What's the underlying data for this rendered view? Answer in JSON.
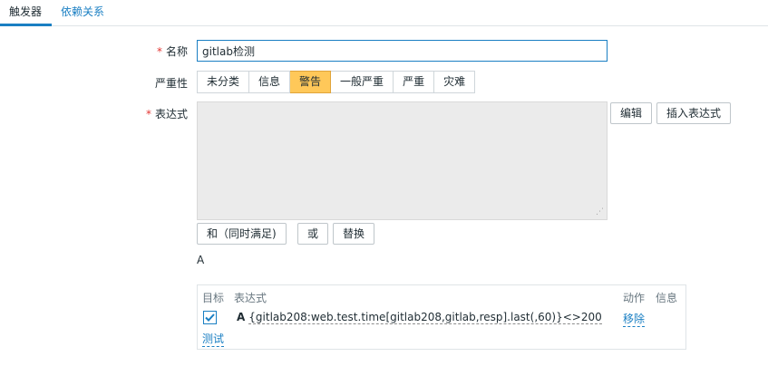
{
  "tabs": [
    {
      "label": "触发器"
    },
    {
      "label": "依赖关系"
    }
  ],
  "form": {
    "name_label": "名称",
    "name_value": "gitlab检测",
    "severity_label": "严重性",
    "severity_options": [
      "未分类",
      "信息",
      "警告",
      "一般严重",
      "严重",
      "灾难"
    ],
    "severity_selected": "警告",
    "expression_label": "表达式",
    "required_mark": "*",
    "edit_button": "编辑",
    "insert_expression_button": "插入表达式",
    "and_button": "和（同时满足)",
    "or_button": "或",
    "replace_button": "替换",
    "expression_letter": "A"
  },
  "expression_table": {
    "headers": {
      "target": "目标",
      "expression": "表达式",
      "action": "动作",
      "info": "信息"
    },
    "rows": [
      {
        "letter": "A",
        "expression": "{gitlab208:web.test.time[gitlab208,gitlab,resp].last(,60)}<>200",
        "checked": true,
        "action_label": "移除"
      }
    ],
    "test_link": "测试"
  },
  "colors": {
    "accent": "#1a7fc3",
    "warning_selected": "#ffc859",
    "required": "#e33734"
  }
}
